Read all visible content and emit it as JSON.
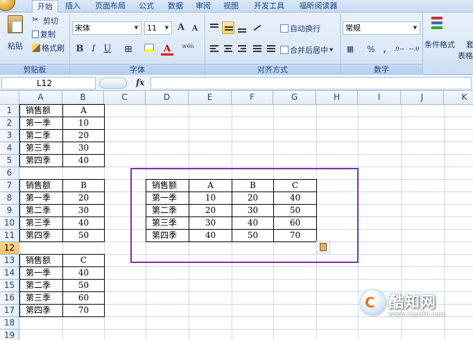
{
  "ribbon": {
    "tabs": [
      "开始",
      "插入",
      "页面布局",
      "公式",
      "数据",
      "审阅",
      "视图",
      "开发工具",
      "福昕阅读器"
    ],
    "clipboard": {
      "paste": "粘贴",
      "cut": "剪切",
      "copy": "复制",
      "format_painter": "格式刷",
      "caption": "剪贴板"
    },
    "font": {
      "name": "宋体",
      "size": "11",
      "caption": "字体",
      "bold": "B",
      "italic": "I",
      "underline": "U",
      "grow": "A",
      "shrink": "A",
      "phonetic": "wén"
    },
    "alignment": {
      "wrap_text": "自动换行",
      "merge_center": "合并后居中",
      "caption": "对齐方式"
    },
    "number": {
      "format": "常规",
      "percent": "%",
      "comma": ",",
      "caption": "数字"
    },
    "styles": {
      "conditional": "条件格式",
      "table_partial_1": "套",
      "table_partial_2": "表格"
    }
  },
  "formula_bar": {
    "name_box": "L12",
    "fx": "fx",
    "value": ""
  },
  "grid": {
    "columns": [
      "A",
      "B",
      "C",
      "D",
      "E",
      "F",
      "G",
      "H",
      "I",
      "J",
      "K"
    ],
    "rows": [
      "1",
      "2",
      "3",
      "4",
      "5",
      "6",
      "7",
      "8",
      "9",
      "10",
      "11",
      "12",
      "13",
      "14",
      "15",
      "16",
      "17",
      "18",
      "19"
    ],
    "active_row": "12",
    "table1": [
      [
        "销售额",
        "A"
      ],
      [
        "第一季",
        "10"
      ],
      [
        "第二季",
        "20"
      ],
      [
        "第三季",
        "30"
      ],
      [
        "第四季",
        "40"
      ]
    ],
    "table2": [
      [
        "销售额",
        "B"
      ],
      [
        "第一季",
        "20"
      ],
      [
        "第二季",
        "30"
      ],
      [
        "第三季",
        "40"
      ],
      [
        "第四季",
        "50"
      ]
    ],
    "table3": [
      [
        "销售额",
        "C"
      ],
      [
        "第一季",
        "40"
      ],
      [
        "第二季",
        "50"
      ],
      [
        "第三季",
        "60"
      ],
      [
        "第四季",
        "70"
      ]
    ],
    "combined": [
      [
        "销售额",
        "A",
        "B",
        "C"
      ],
      [
        "第一季",
        "10",
        "20",
        "40"
      ],
      [
        "第二季",
        "20",
        "30",
        "50"
      ],
      [
        "第三季",
        "30",
        "40",
        "60"
      ],
      [
        "第四季",
        "40",
        "50",
        "70"
      ]
    ]
  },
  "watermark": {
    "title": "酷知网",
    "url": "www.coozhi.com"
  }
}
